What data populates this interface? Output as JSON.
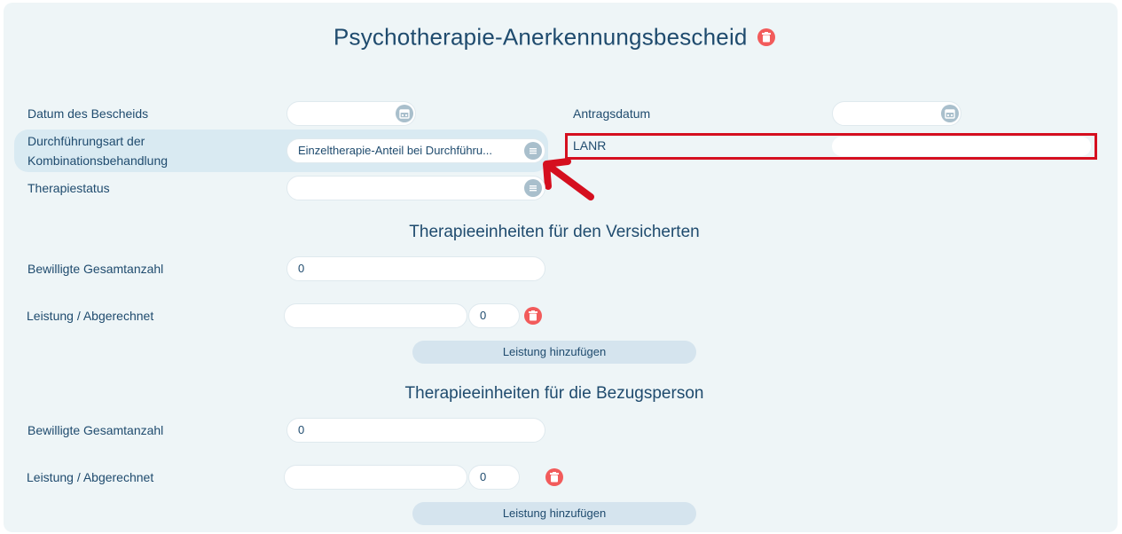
{
  "page_title": "Psychotherapie-Anerkennungsbescheid",
  "fields": {
    "datum_label": "Datum des Bescheids",
    "datum_value": "",
    "antragsdatum_label": "Antragsdatum",
    "antragsdatum_value": "",
    "durchfuehrung_label_line1": "Durchführungsart der",
    "durchfuehrung_label_line2": "Kombinationsbehandlung",
    "durchfuehrung_value": "Einzeltherapie-Anteil bei Durchführu...",
    "lanr_label": "LANR",
    "lanr_value": "",
    "therapiestatus_label": "Therapiestatus",
    "therapiestatus_value": ""
  },
  "sections": [
    {
      "title": "Therapieeinheiten für den Versicherten",
      "bewilligt_label": "Bewilligte Gesamtanzahl",
      "bewilligt_value": "0",
      "leistung_label": "Leistung / Abgerechnet",
      "leistung_value": "",
      "abgerechnet_value": "0",
      "add_button": "Leistung hinzufügen"
    },
    {
      "title": "Therapieeinheiten für die Bezugsperson",
      "bewilligt_label": "Bewilligte Gesamtanzahl",
      "bewilligt_value": "0",
      "leistung_label": "Leistung / Abgerechnet",
      "leistung_value": "",
      "abgerechnet_value": "0",
      "add_button": "Leistung hinzufügen"
    }
  ],
  "colors": {
    "panel_bg": "#eef5f7",
    "text": "#1f4b6e",
    "delete": "#f25b5b",
    "highlight_box": "#d50f1f",
    "annotation_arrow": "#d50f1f"
  },
  "icons": {
    "title_delete": "trash-icon",
    "date_picker": "calendar-icon",
    "select": "menu-lines-icon",
    "row_delete": "trash-icon"
  }
}
